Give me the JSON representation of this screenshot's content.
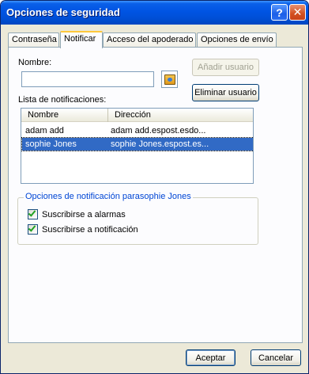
{
  "window": {
    "title": "Opciones de seguridad",
    "help_glyph": "?",
    "close_glyph": "✕"
  },
  "tabs": [
    {
      "label": "Contraseña"
    },
    {
      "label": "Notificar",
      "active": true
    },
    {
      "label": "Acceso del apoderado"
    },
    {
      "label": "Opciones de envío"
    }
  ],
  "form": {
    "name_label": "Nombre:",
    "name_value": "",
    "add_user_label": "Añadir usuario",
    "remove_user_label": "Eliminar usuario",
    "list_label": "Lista de notificaciones:"
  },
  "list": {
    "columns": [
      "Nombre",
      "Dirección"
    ],
    "rows": [
      {
        "name": "adam add",
        "address": "adam add.espost.esdo...",
        "selected": false
      },
      {
        "name": "sophie Jones",
        "address": "sophie Jones.espost.es...",
        "selected": true
      }
    ]
  },
  "options": {
    "group_title": "Opciones de notificación parasophie Jones",
    "alarms_label": "Suscribirse a alarmas",
    "alarms_checked": true,
    "notify_label": "Suscribirse a notificación",
    "notify_checked": true
  },
  "footer": {
    "accept_label": "Aceptar",
    "cancel_label": "Cancelar"
  },
  "colors": {
    "titlebar": "#0054e3",
    "selection": "#316ac5",
    "group_title": "#0046d5",
    "check": "#21a121"
  },
  "icons": {
    "address_book": "address-book-icon"
  }
}
